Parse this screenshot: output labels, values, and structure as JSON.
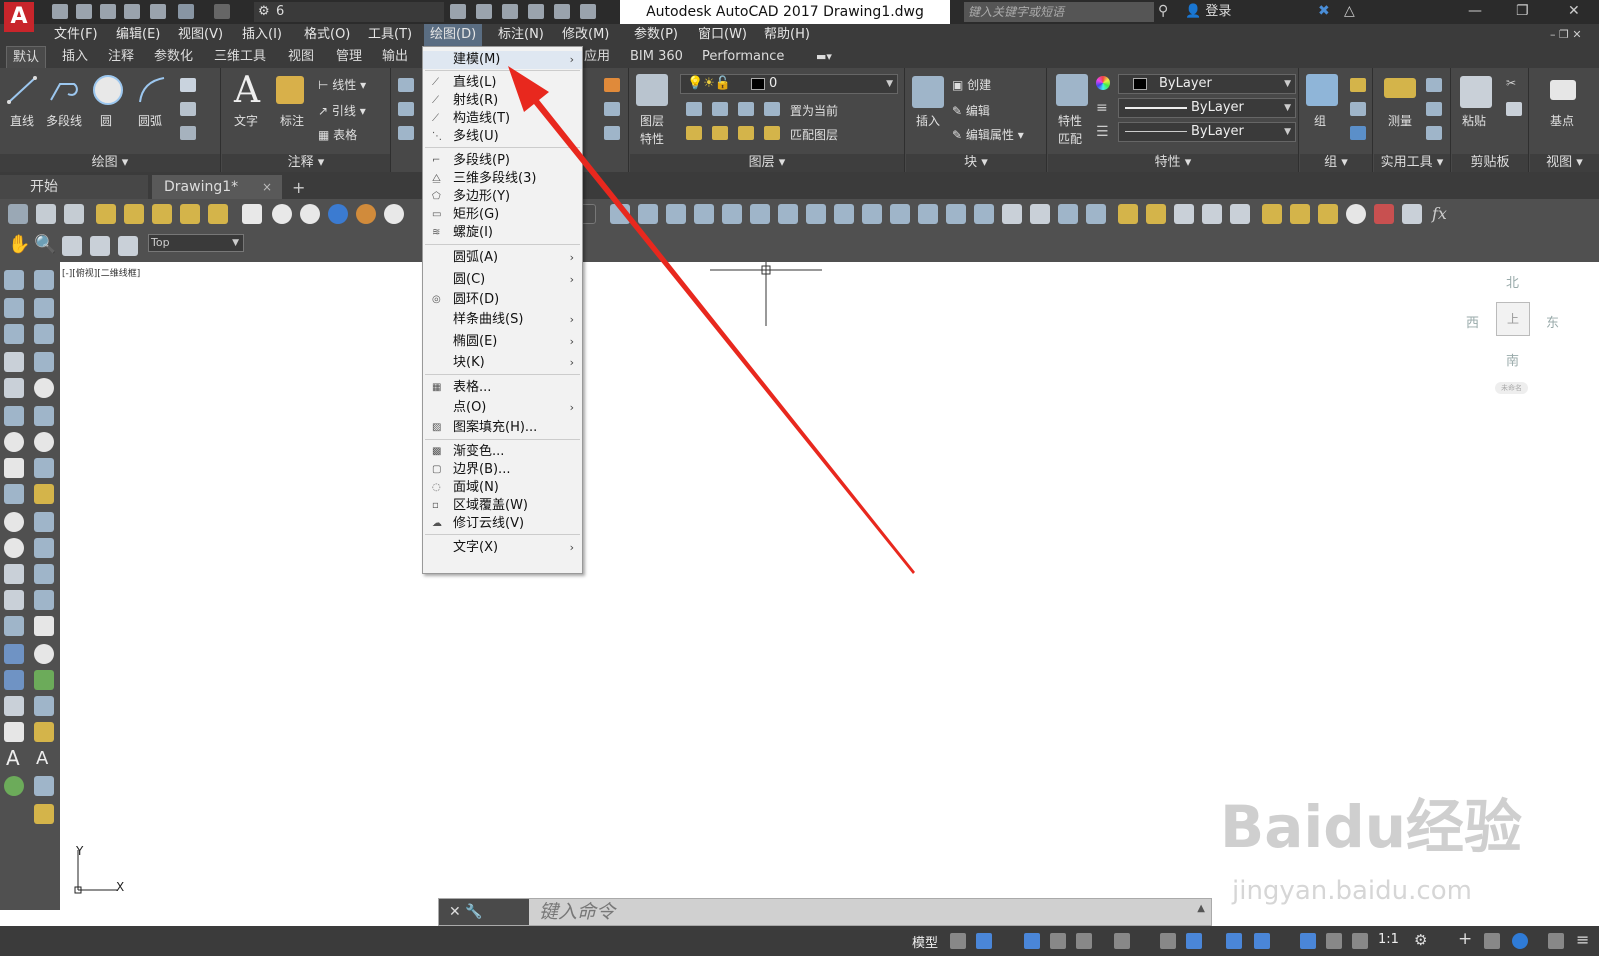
{
  "window": {
    "app_logo": "A",
    "title": "Autodesk AutoCAD 2017    Drawing1.dwg",
    "workspace": "6",
    "search_placeholder": "键入关键字或短语",
    "login": "登录"
  },
  "menubar": {
    "items": [
      "文件(F)",
      "编辑(E)",
      "视图(V)",
      "插入(I)",
      "格式(O)",
      "工具(T)",
      "绘图(D)",
      "标注(N)",
      "修改(M)",
      "参数(P)",
      "窗口(W)",
      "帮助(H)"
    ],
    "active": "绘图(D)"
  },
  "ribbon": {
    "tabs": [
      "默认",
      "插入",
      "注释",
      "参数化",
      "三维工具",
      "视图",
      "管理",
      "输出",
      "应用",
      "BIM 360",
      "Performance"
    ],
    "active_tab": "默认",
    "draw_panel": {
      "line": "直线",
      "polyline": "多段线",
      "circle": "圆",
      "arc": "圆弧",
      "footer": "绘图"
    },
    "annotation_panel": {
      "text": "文字",
      "dimension": "标注",
      "linear": "线性",
      "leader": "引线",
      "table": "表格",
      "footer": "注释"
    },
    "layers_panel": {
      "layer_props_1": "图层",
      "layer_props_2": "特性",
      "current_layer": "0",
      "set_current": "置为当前",
      "match_layer": "匹配图层",
      "footer": "图层"
    },
    "block_panel": {
      "insert": "插入",
      "create": "创建",
      "edit": "编辑",
      "edit_attrs": "编辑属性",
      "footer": "块"
    },
    "properties_panel": {
      "match_1": "特性",
      "match_2": "匹配",
      "color": "ByLayer",
      "linetype": "ByLayer",
      "lineweight": "ByLayer",
      "footer": "特性"
    },
    "group_panel": {
      "group": "组",
      "footer": "组"
    },
    "utilities_panel": {
      "measure": "测量",
      "footer": "实用工具"
    },
    "clipboard_panel": {
      "paste": "粘贴",
      "footer": "剪贴板"
    },
    "view_panel": {
      "base": "基点",
      "footer": "视图"
    }
  },
  "file_tabs": {
    "start": "开始",
    "drawing": "Drawing1*",
    "close": "×",
    "add": "+"
  },
  "toolbar2": {
    "view_select": "Top"
  },
  "canvas": {
    "viewport_label": "[-][俯视][二维线框]",
    "viewcube": {
      "north": "北",
      "south": "南",
      "east": "东",
      "west": "西",
      "face": "上",
      "wcs": "未命名"
    },
    "ucs": {
      "x": "X",
      "y": "Y"
    }
  },
  "command_line": {
    "buttons": "✕  🔧",
    "placeholder": "键入命令"
  },
  "statusbar": {
    "model": "模型",
    "scale": "1:1"
  },
  "draw_menu": {
    "items": [
      {
        "label": "建模(M)",
        "icon": "",
        "submenu": true
      },
      {
        "label": "直线(L)",
        "icon": "⟋",
        "submenu": false
      },
      {
        "label": "射线(R)",
        "icon": "⟋",
        "submenu": false
      },
      {
        "label": "构造线(T)",
        "icon": "⟋",
        "submenu": false
      },
      {
        "label": "多线(U)",
        "icon": "⋱",
        "submenu": false
      },
      {
        "label": "多段线(P)",
        "icon": "⌐",
        "submenu": false
      },
      {
        "label": "三维多段线(3)",
        "icon": "⧋",
        "submenu": false
      },
      {
        "label": "多边形(Y)",
        "icon": "⬠",
        "submenu": false
      },
      {
        "label": "矩形(G)",
        "icon": "▭",
        "submenu": false
      },
      {
        "label": "螺旋(I)",
        "icon": "≋",
        "submenu": false
      },
      {
        "label": "圆弧(A)",
        "icon": "",
        "submenu": true
      },
      {
        "label": "圆(C)",
        "icon": "",
        "submenu": true
      },
      {
        "label": "圆环(D)",
        "icon": "◎",
        "submenu": false
      },
      {
        "label": "样条曲线(S)",
        "icon": "",
        "submenu": true
      },
      {
        "label": "椭圆(E)",
        "icon": "",
        "submenu": true
      },
      {
        "label": "块(K)",
        "icon": "",
        "submenu": true
      },
      {
        "label": "表格...",
        "icon": "▦",
        "submenu": false
      },
      {
        "label": "点(O)",
        "icon": "",
        "submenu": true
      },
      {
        "label": "图案填充(H)...",
        "icon": "▨",
        "submenu": false
      },
      {
        "label": "渐变色...",
        "icon": "▩",
        "submenu": false
      },
      {
        "label": "边界(B)...",
        "icon": "▢",
        "submenu": false
      },
      {
        "label": "面域(N)",
        "icon": "◌",
        "submenu": false
      },
      {
        "label": "区域覆盖(W)",
        "icon": "▫",
        "submenu": false
      },
      {
        "label": "修订云线(V)",
        "icon": "☁",
        "submenu": false
      },
      {
        "label": "文字(X)",
        "icon": "",
        "submenu": true
      }
    ],
    "submenu_arrow": "›"
  },
  "watermark": {
    "text": "Baidu经验",
    "url": "jingyan.baidu.com"
  },
  "colors": {
    "annotation_arrow": "#e8281e",
    "menu_highlight": "#5a6d82",
    "app_logo": "#c8252b"
  }
}
